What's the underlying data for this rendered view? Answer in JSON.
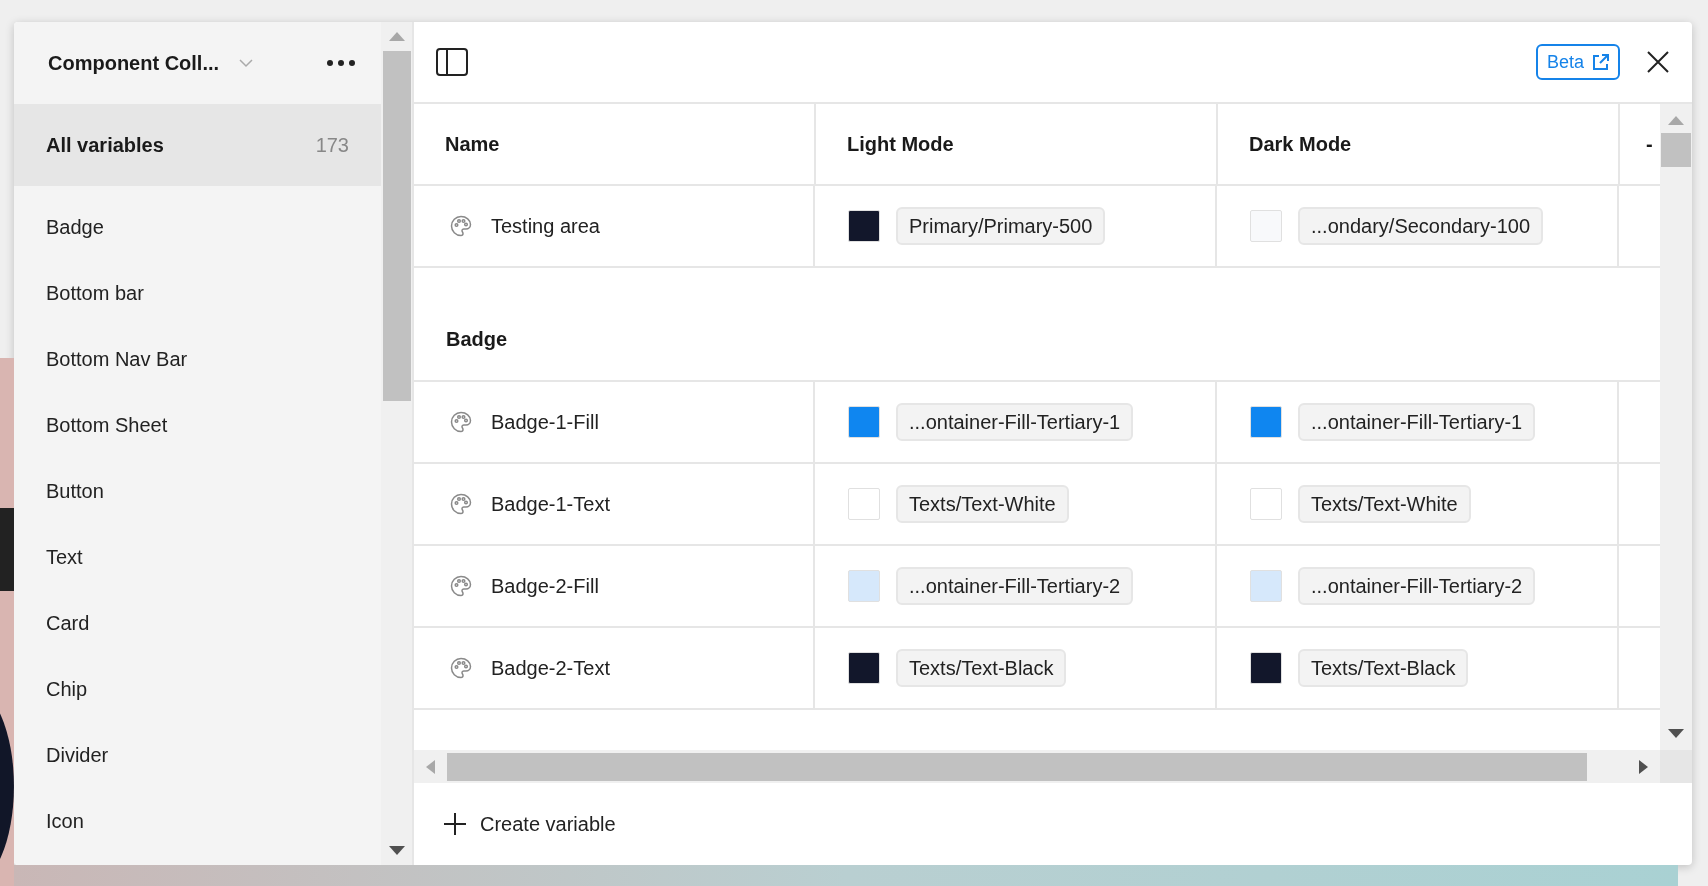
{
  "sidebar": {
    "collection_title": "Component Coll...",
    "items": [
      {
        "label": "All variables",
        "count": "173",
        "selected": true
      },
      {
        "label": "Badge",
        "selected": false
      },
      {
        "label": "Bottom bar",
        "selected": false
      },
      {
        "label": "Bottom Nav Bar",
        "selected": false
      },
      {
        "label": "Bottom Sheet",
        "selected": false
      },
      {
        "label": "Button",
        "selected": false
      },
      {
        "label": "Text",
        "selected": false
      },
      {
        "label": "Card",
        "selected": false
      },
      {
        "label": "Chip",
        "selected": false
      },
      {
        "label": "Divider",
        "selected": false
      },
      {
        "label": "Icon",
        "selected": false
      }
    ]
  },
  "toolbar": {
    "beta_label": "Beta"
  },
  "table": {
    "columns": [
      "Name",
      "Light Mode",
      "Dark Mode",
      "-"
    ],
    "rows": [
      {
        "kind": "variable",
        "name": "Testing area",
        "light": {
          "color": "#12172b",
          "value": "Primary/Primary-500"
        },
        "dark": {
          "color": "#f8f9fb",
          "value": "...ondary/Secondary-100"
        }
      },
      {
        "kind": "group",
        "name": "Badge"
      },
      {
        "kind": "variable",
        "name": "Badge-1-Fill",
        "light": {
          "color": "#0f86f0",
          "value": "...ontainer-Fill-Tertiary-1"
        },
        "dark": {
          "color": "#0f86f0",
          "value": "...ontainer-Fill-Tertiary-1"
        }
      },
      {
        "kind": "variable",
        "name": "Badge-1-Text",
        "light": {
          "color": "#ffffff",
          "value": "Texts/Text-White"
        },
        "dark": {
          "color": "#ffffff",
          "value": "Texts/Text-White"
        }
      },
      {
        "kind": "variable",
        "name": "Badge-2-Fill",
        "light": {
          "color": "#d6e8fb",
          "value": "...ontainer-Fill-Tertiary-2"
        },
        "dark": {
          "color": "#d6e8fb",
          "value": "...ontainer-Fill-Tertiary-2"
        }
      },
      {
        "kind": "variable",
        "name": "Badge-2-Text",
        "light": {
          "color": "#12172b",
          "value": "Texts/Text-Black"
        },
        "dark": {
          "color": "#12172b",
          "value": "Texts/Text-Black"
        }
      }
    ]
  },
  "footer": {
    "create_label": "Create variable"
  }
}
